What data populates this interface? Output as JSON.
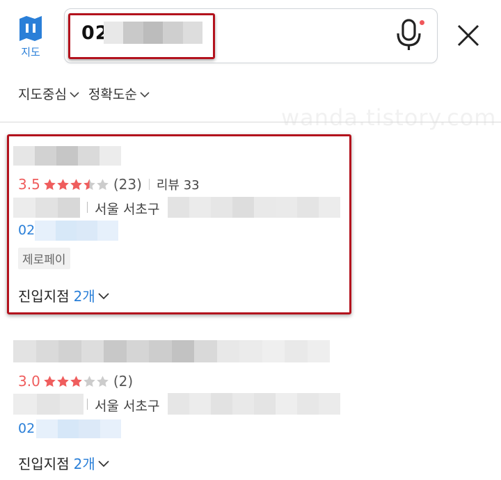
{
  "header": {
    "map_button_label": "지도",
    "search_query": "02",
    "icons": {
      "map": "map-icon",
      "mic": "microphone-icon",
      "close": "close-icon"
    }
  },
  "filters": [
    {
      "label": "지도중심"
    },
    {
      "label": "정확도순"
    }
  ],
  "watermark": "wanda.tistory.com",
  "results": [
    {
      "rating": "3.5",
      "stars": 3.5,
      "rating_count": "(23)",
      "review_label": "리뷰 33",
      "address_prefix": "서울 서초구",
      "phone_prefix": "02",
      "tag": "제로페이",
      "branches_label": "진입지점",
      "branches_count": "2개"
    },
    {
      "rating": "3.0",
      "stars": 3,
      "rating_count": "(2)",
      "address_prefix": "서울 서초구",
      "phone_prefix": "02",
      "branches_label": "진입지점",
      "branches_count": "2개"
    }
  ],
  "colors": {
    "accent_blue": "#2a7fd8",
    "rating_red": "#ef5d5d",
    "highlight_red": "#b3121d"
  }
}
